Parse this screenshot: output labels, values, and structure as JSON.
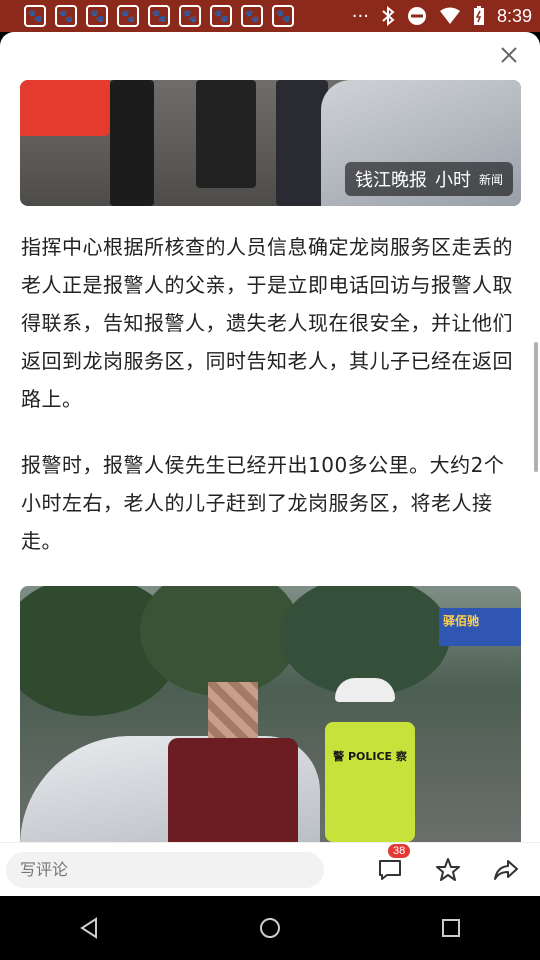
{
  "status_bar": {
    "app_icons": [
      "🐾",
      "🐾",
      "🐾",
      "🐾",
      "🐾",
      "🐾",
      "🐾",
      "🐾",
      "🐾"
    ],
    "more": "···",
    "time": "8:39"
  },
  "article": {
    "image_top_watermark": {
      "brand": "钱江晚报",
      "sub": "小时",
      "sub2": "新闻"
    },
    "paragraphs": [
      "指挥中心根据所核查的人员信息确定龙岗服务区走丢的老人正是报警人的父亲，于是立即电话回访与报警人取得联系，告知报警人，遗失老人现在很安全，并让他们返回到龙岗服务区，同时告知老人，其儿子已经在返回路上。",
      "报警时，报警人侯先生已经开出100多公里。大约2个小时左右，老人的儿子赶到了龙岗服务区，将老人接走。"
    ],
    "image_bottom": {
      "sign_text": "驿佰驰",
      "vest_text": "警 POLICE 察"
    }
  },
  "bottom_bar": {
    "comment_placeholder": "写评论",
    "comment_count": "38"
  },
  "icons": {
    "close": "close-icon",
    "comment": "comment-icon",
    "star": "star-icon",
    "share": "share-icon"
  }
}
